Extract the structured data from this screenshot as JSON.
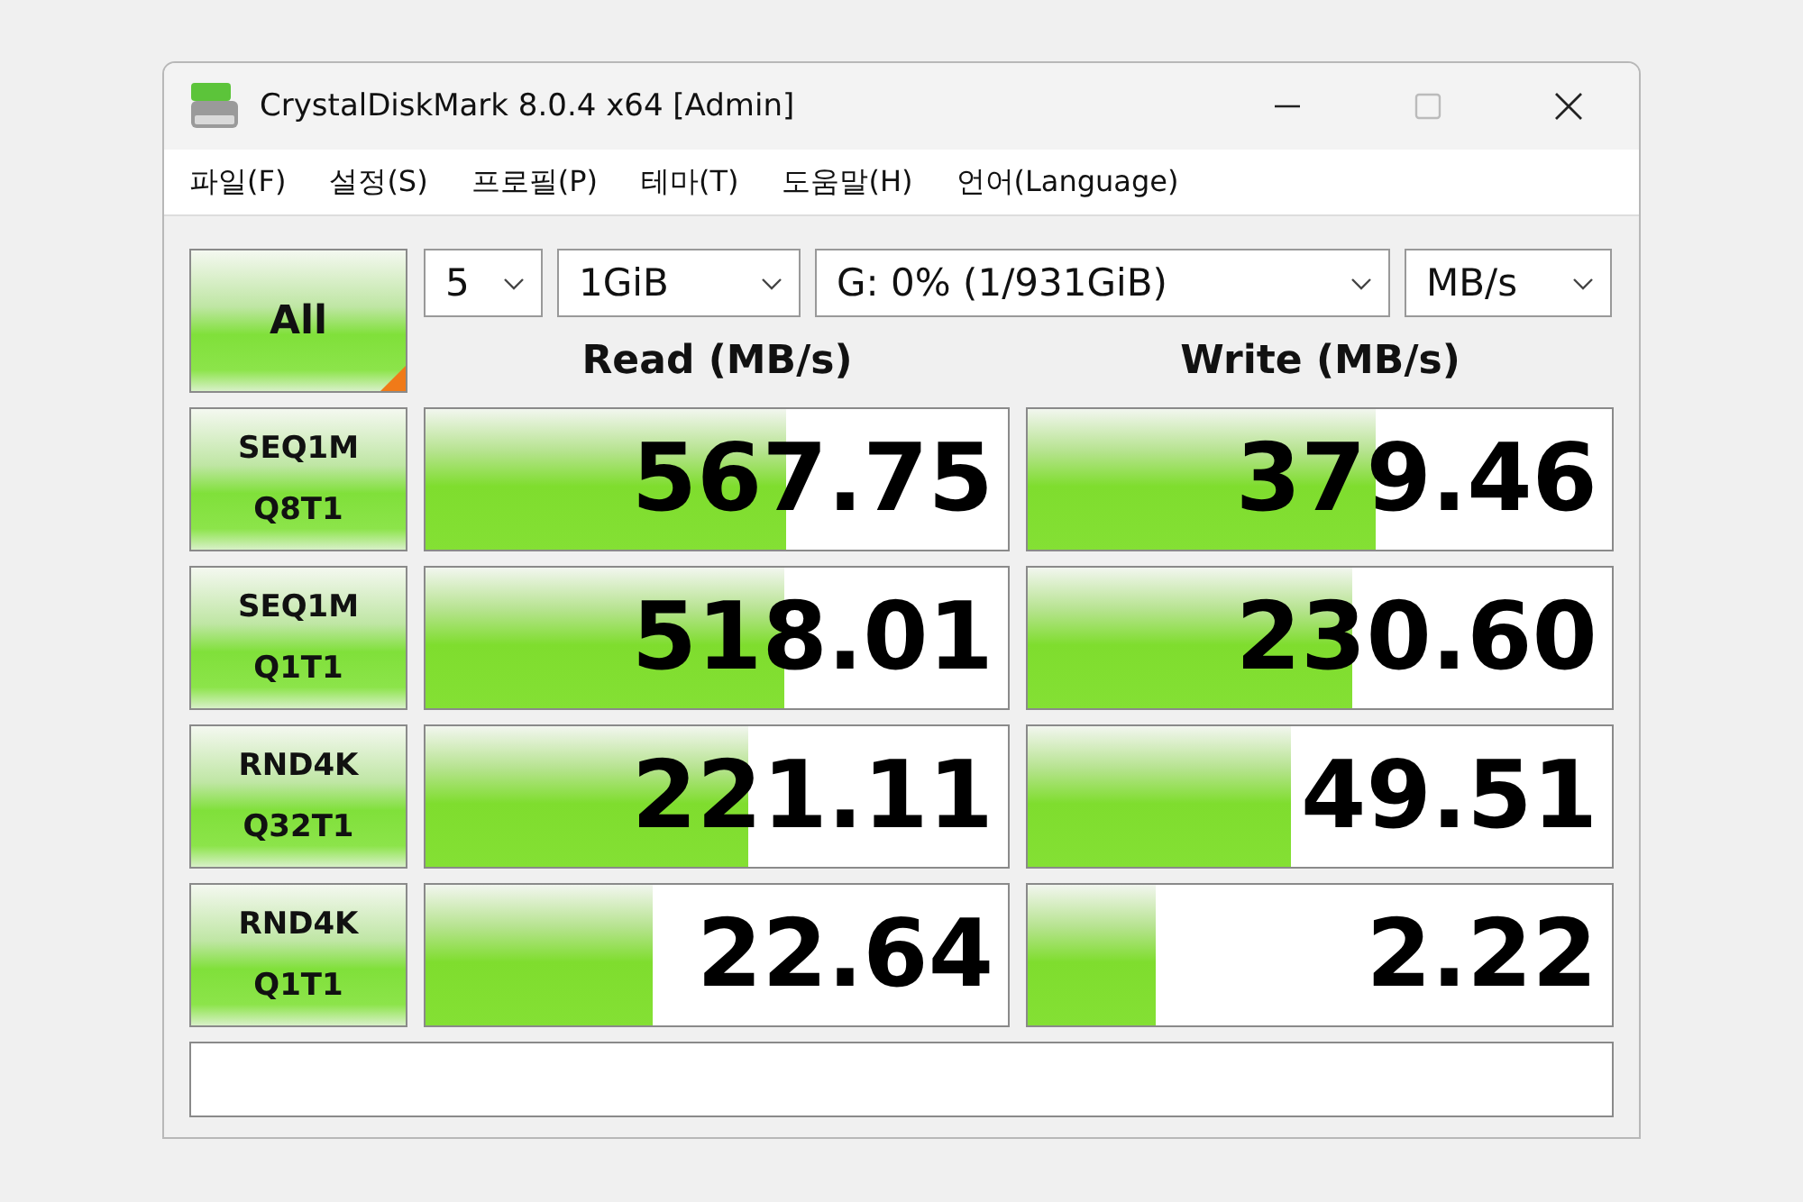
{
  "window": {
    "title": "CrystalDiskMark 8.0.4 x64 [Admin]",
    "controls": [
      {
        "kind": "minimize",
        "disabled": false
      },
      {
        "kind": "maximize",
        "disabled": true
      },
      {
        "kind": "close",
        "disabled": false
      }
    ]
  },
  "menu": [
    "파일(F)",
    "설정(S)",
    "프로필(P)",
    "테마(T)",
    "도움말(H)",
    "언어(Language)"
  ],
  "all_button": "All",
  "selects": [
    {
      "kind": "count",
      "value": "5"
    },
    {
      "kind": "size",
      "value": "1GiB"
    },
    {
      "kind": "drive",
      "value": "G: 0% (1/931GiB)"
    },
    {
      "kind": "unit",
      "value": "MB/s"
    }
  ],
  "headers": [
    "Read (MB/s)",
    "Write (MB/s)"
  ],
  "rows": [
    {
      "label": [
        "SEQ1M",
        "Q8T1"
      ],
      "read": {
        "value": "567.75",
        "level": 0.62
      },
      "write": {
        "value": "379.46",
        "level": 0.595
      }
    },
    {
      "label": [
        "SEQ1M",
        "Q1T1"
      ],
      "read": {
        "value": "518.01",
        "level": 0.615
      },
      "write": {
        "value": "230.60",
        "level": 0.555
      }
    },
    {
      "label": [
        "RND4K",
        "Q32T1"
      ],
      "read": {
        "value": "221.11",
        "level": 0.555
      },
      "write": {
        "value": "49.51",
        "level": 0.45
      }
    },
    {
      "label": [
        "RND4K",
        "Q1T1"
      ],
      "read": {
        "value": "22.64",
        "level": 0.39
      },
      "write": {
        "value": "2.22",
        "level": 0.22
      }
    }
  ]
}
